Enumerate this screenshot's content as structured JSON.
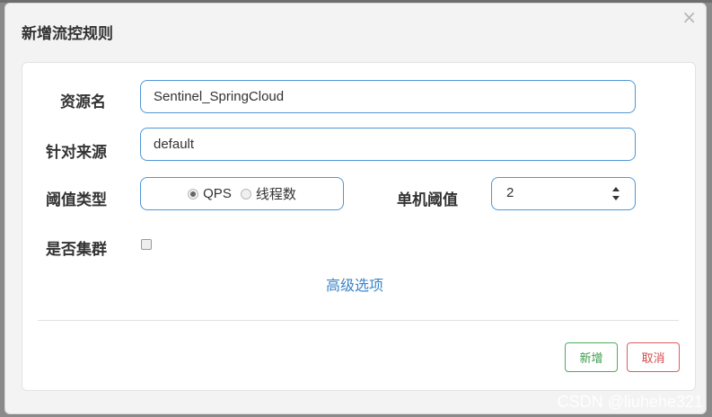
{
  "dialog": {
    "title": "新增流控规则",
    "close_glyph": "×"
  },
  "form": {
    "resource": {
      "label": "资源名",
      "value": "Sentinel_SpringCloud"
    },
    "source": {
      "label": "针对来源",
      "value": "default"
    },
    "threshold_type": {
      "label": "阈值类型",
      "options": [
        {
          "label": "QPS",
          "checked": true
        },
        {
          "label": "线程数",
          "checked": false
        }
      ]
    },
    "threshold": {
      "label": "单机阈值",
      "value": "2"
    },
    "cluster": {
      "label": "是否集群",
      "checked": false
    },
    "advanced_label": "高级选项"
  },
  "buttons": {
    "add_label": "新增",
    "cancel_label": "取消"
  },
  "watermark": "CSDN @liuhehe321",
  "colors": {
    "input_border": "#4f97d6",
    "link": "#3a84c8",
    "add_button": "#4aae5b",
    "cancel_button": "#dd5e5e"
  }
}
